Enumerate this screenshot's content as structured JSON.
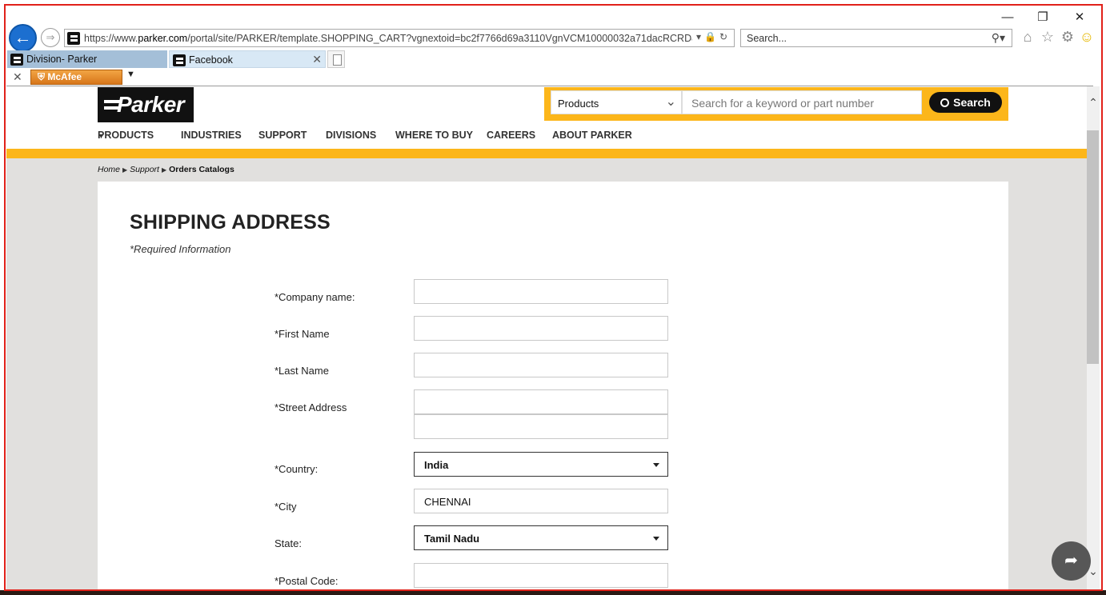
{
  "browser": {
    "url_prefix": "https://www.",
    "url_domain": "parker.com",
    "url_rest": "/portal/site/PARKER/template.SHOPPING_CART?vgnextoid=bc2f7766d69a3110VgnVCM10000032a71dacRCRD&sessionIc",
    "search_placeholder": "Search...",
    "tabs": [
      {
        "label": "Division- Parker"
      },
      {
        "label": "Facebook"
      }
    ],
    "toolbar_addon": "McAfee"
  },
  "site": {
    "logo_text": "Parker",
    "search": {
      "category": "Products",
      "placeholder": "Search for a keyword or part number",
      "button_label": "Search"
    },
    "nav": [
      {
        "label": "PRODUCTS"
      },
      {
        "label": "INDUSTRIES"
      },
      {
        "label": "SUPPORT"
      },
      {
        "label": "DIVISIONS"
      },
      {
        "label": "WHERE TO BUY"
      },
      {
        "label": "CAREERS"
      },
      {
        "label": "ABOUT PARKER"
      }
    ],
    "breadcrumb": {
      "home": "Home",
      "support": "Support",
      "current": "Orders Catalogs"
    }
  },
  "form": {
    "title": "SHIPPING ADDRESS",
    "required_note": "*Required Information",
    "fields": {
      "company_label": "*Company name:",
      "first_name_label": "*First Name",
      "last_name_label": "*Last Name",
      "street_label": "*Street Address",
      "country_label": "*Country:",
      "country_value": "India",
      "city_label": "*City",
      "city_value": "CHENNAI",
      "state_label": "State:",
      "state_value": "Tamil Nadu",
      "postal_label": "*Postal Code:"
    }
  },
  "colors": {
    "brand_yellow": "#fcb61a",
    "frame_red": "#e1211a"
  }
}
